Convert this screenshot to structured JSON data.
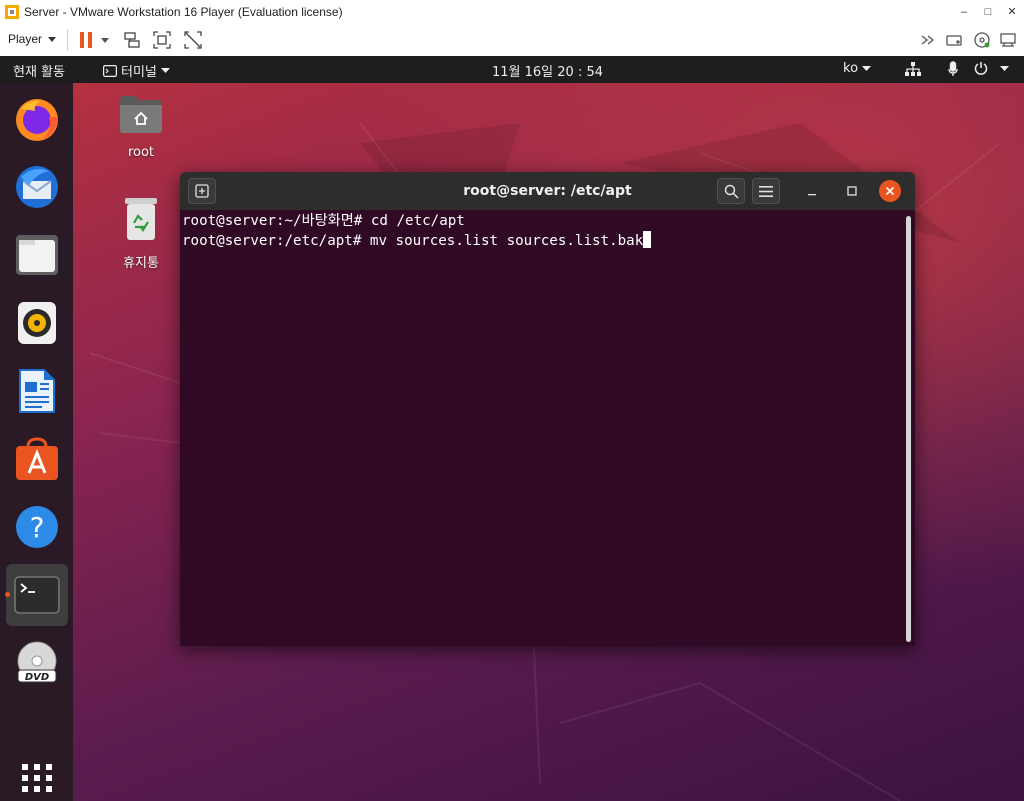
{
  "vm_window": {
    "title": "Server - VMware Workstation 16 Player (Evaluation license)",
    "controls": [
      "–",
      "□",
      "✕"
    ]
  },
  "vm_toolbar": {
    "player_label": "Player"
  },
  "topbar": {
    "activities": "현재 활동",
    "app_menu": "터미널",
    "clock": "11월 16일  20 : 54",
    "language": "ko"
  },
  "dock": {
    "items": [
      {
        "name": "firefox-icon"
      },
      {
        "name": "thunderbird-icon"
      },
      {
        "name": "files-icon"
      },
      {
        "name": "rhythmbox-icon"
      },
      {
        "name": "libreoffice-writer-icon"
      },
      {
        "name": "ubuntu-software-icon"
      },
      {
        "name": "help-icon"
      },
      {
        "name": "terminal-icon",
        "active": true
      },
      {
        "name": "dvd-icon"
      },
      {
        "name": "show-applications-icon"
      }
    ]
  },
  "desktop_icons": [
    {
      "label": "root",
      "icon": "home-folder-icon"
    },
    {
      "label": "휴지통",
      "icon": "trash-icon"
    }
  ],
  "terminal": {
    "title": "root@server: /etc/apt",
    "lines": [
      "root@server:~/바탕화면# cd /etc/apt",
      "root@server:/etc/apt# mv sources.list sources.list.bak"
    ]
  },
  "colors": {
    "terminal_bg": "#300a24",
    "ubuntu_orange": "#e95420",
    "topbar_bg": "#1e1e1e"
  }
}
